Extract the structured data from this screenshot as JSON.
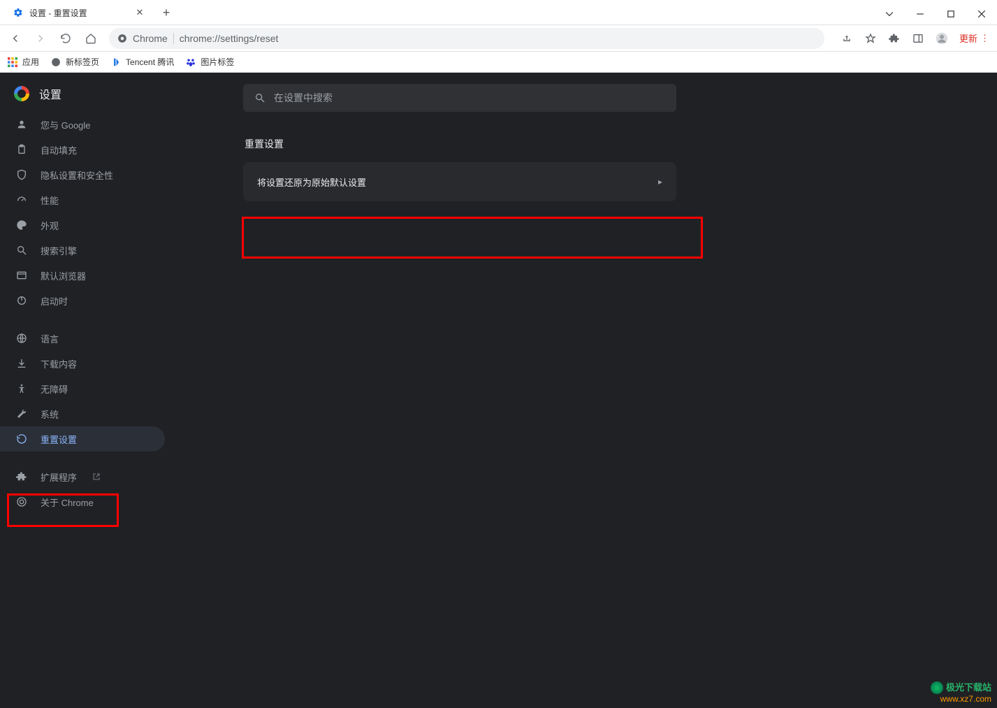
{
  "window": {
    "tab_title": "设置 - 重置设置"
  },
  "toolbar": {
    "chrome_label": "Chrome",
    "url": "chrome://settings/reset",
    "update_label": "更新"
  },
  "bookmarks": {
    "apps": "应用",
    "newtab": "新标签页",
    "tencent": "Tencent 腾讯",
    "images": "图片标签"
  },
  "settings": {
    "title": "设置",
    "search_placeholder": "在设置中搜索",
    "sidebar": {
      "you_google": "您与 Google",
      "autofill": "自动填充",
      "privacy": "隐私设置和安全性",
      "performance": "性能",
      "appearance": "外观",
      "search_engine": "搜索引擎",
      "default_browser": "默认浏览器",
      "on_startup": "启动时",
      "languages": "语言",
      "downloads": "下载内容",
      "accessibility": "无障碍",
      "system": "系统",
      "reset": "重置设置",
      "extensions": "扩展程序",
      "about": "关于 Chrome"
    },
    "section": {
      "title": "重置设置",
      "row_label": "将设置还原为原始默认设置"
    }
  },
  "watermark": {
    "line1": "极光下载站",
    "line2": "www.xz7.com"
  }
}
